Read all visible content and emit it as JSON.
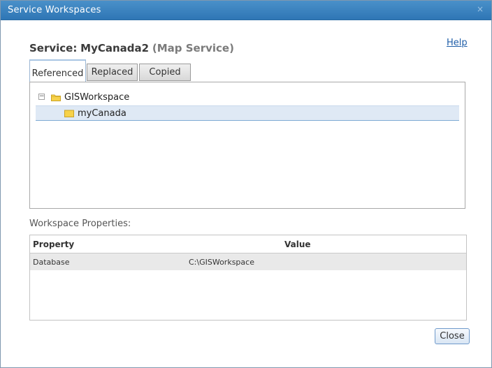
{
  "window": {
    "title": "Service Workspaces",
    "close_glyph": "×"
  },
  "header": {
    "service_label": "Service:",
    "service_name": "MyCanada2",
    "service_type": "(Map Service)",
    "help_link": "Help"
  },
  "tabs": [
    {
      "label": "Referenced",
      "active": true
    },
    {
      "label": "Replaced",
      "active": false
    },
    {
      "label": "Copied",
      "active": false
    }
  ],
  "tree": {
    "root": {
      "label": "GISWorkspace",
      "expanded": true,
      "expander_glyph": "−"
    },
    "children": [
      {
        "label": "myCanada",
        "selected": true
      }
    ]
  },
  "workspace_properties": {
    "label": "Workspace Properties:",
    "columns": [
      "Property",
      "Value"
    ],
    "rows": [
      {
        "property": "Database",
        "value": "C:\\GISWorkspace"
      }
    ]
  },
  "footer": {
    "close_label": "Close"
  },
  "colors": {
    "titlebar": "#2f76b5",
    "selection": "#dfe9f5",
    "folder": "#f7d24a"
  }
}
